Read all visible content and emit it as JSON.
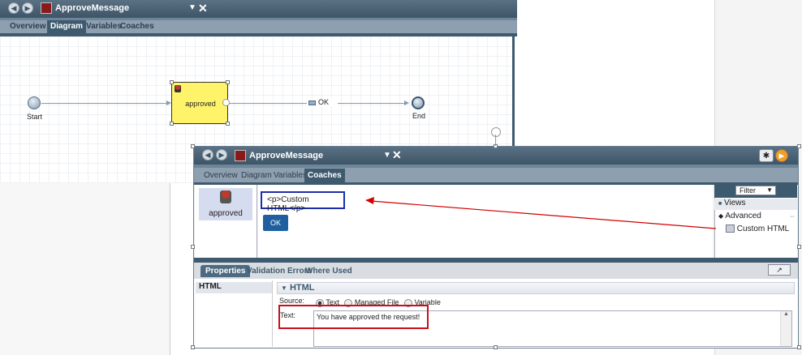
{
  "background_editor": {
    "title": "ApproveMessage",
    "tabs": [
      "Overview",
      "Diagram",
      "Variables",
      "Coaches"
    ],
    "active_tab": "Diagram",
    "diagram": {
      "start_label": "Start",
      "activity_label": "approved",
      "flow_label": "OK",
      "end_label": "End"
    }
  },
  "foreground_editor": {
    "title": "ApproveMessage",
    "tabs": [
      "Overview",
      "Diagram",
      "Variables",
      "Coaches"
    ],
    "active_tab": "Coaches",
    "coach_item": "approved",
    "custom_html_preview": "<p>Custom HTML</p>",
    "ok_button": "OK",
    "palette": {
      "filter_label": "Filter",
      "views_label": "Views",
      "advanced_label": "Advanced",
      "custom_html_label": "Custom HTML"
    },
    "properties": {
      "tabs": [
        "Properties",
        "Validation Errors",
        "Where Used"
      ],
      "active_tab": "Properties",
      "left_item": "HTML",
      "section_title": "HTML",
      "source_label": "Source:",
      "source_options": [
        "Text",
        "Managed File",
        "Variable"
      ],
      "source_selected": "Text",
      "text_label": "Text:",
      "text_value": "You have approved the request!"
    }
  },
  "colors": {
    "titlebar": "#3e5567",
    "tabstrip": "#8ea0af",
    "activity_fill": "#fff36a",
    "ok_button": "#1f5fa0",
    "annotation_red": "#d40000"
  }
}
